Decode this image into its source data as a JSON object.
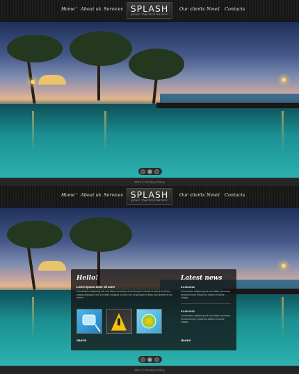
{
  "brand": {
    "title": "SPLASH",
    "subtitle": "pool maintenance"
  },
  "nav": {
    "items": [
      "Home",
      "About us",
      "Services",
      "Our clients",
      "News",
      "Contacts"
    ]
  },
  "footer": {
    "text": "2012 © Privacy Policy"
  },
  "slider": {
    "dot_count": 3,
    "active_dot": 1
  },
  "panel": {
    "hello_heading": "Hello!",
    "hello_subheading": "Lorem ipsum dolor sit amet",
    "hello_text": "Consectetur adipiscing elit, sed diam nonummy eirmod tempor invidunt ut labore et dolore magna aliquyam erat, sed diam voluptua. At vero eos et accusam et justo duo dolores et ea rebum.",
    "hello_more": "more",
    "news_heading": "Latest news",
    "news": [
      {
        "date": "01.06.2012",
        "text": "Consectetur adipiscing elit, sed diam nonummy eirmod tempor invidunt ut labore et dolore magna."
      },
      {
        "date": "01.06.2012",
        "text": "Consectetur adipiscing elit, sed diam nonummy eirmod tempor invidunt ut labore et dolore magna."
      }
    ],
    "news_more": "more"
  },
  "colors": {
    "accent": "#e3b686",
    "pool": "#1a8f91",
    "nav_bg": "#1a1a1a"
  }
}
